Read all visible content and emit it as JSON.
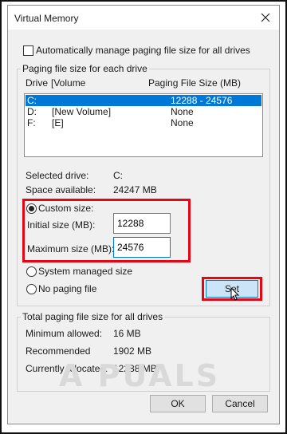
{
  "dialog": {
    "title": "Virtual Memory"
  },
  "auto_manage": {
    "label": "Automatically manage paging file size for all drives",
    "checked": false
  },
  "paging_group": {
    "title": "Paging file size for each drive",
    "columns": {
      "drive": "Drive",
      "volume": "[Volume",
      "size": "Paging File Size (MB)"
    },
    "rows": [
      {
        "drive": "C:",
        "volume": "",
        "size": "12288 - 24576",
        "selected": true
      },
      {
        "drive": "D:",
        "volume": "[New Volume]",
        "size": "None",
        "selected": false
      },
      {
        "drive": "F:",
        "volume": "[E]",
        "size": "None",
        "selected": false
      }
    ],
    "selected_drive_label": "Selected drive:",
    "selected_drive_value": "C:",
    "space_available_label": "Space available:",
    "space_available_value": "24247 MB",
    "custom_size_label": "Custom size:",
    "initial_size_label": "Initial size (MB):",
    "initial_size_value": "12288",
    "maximum_size_label": "Maximum size (MB):",
    "maximum_size_value": "24576",
    "system_managed_label": "System managed size",
    "no_paging_label": "No paging file",
    "set_label": "Set",
    "selected_option": "custom"
  },
  "total_group": {
    "title": "Total paging file size for all drives",
    "minimum_label": "Minimum allowed:",
    "minimum_value": "16 MB",
    "recommended_label": "Recommended",
    "recommended_value": "1902 MB",
    "allocated_label": "Currently allocated:",
    "allocated_value": "12288 MB"
  },
  "buttons": {
    "ok": "OK",
    "cancel": "Cancel"
  },
  "watermark": "A PUALS",
  "colors": {
    "highlight": "#e30613",
    "selection": "#0078d7"
  }
}
